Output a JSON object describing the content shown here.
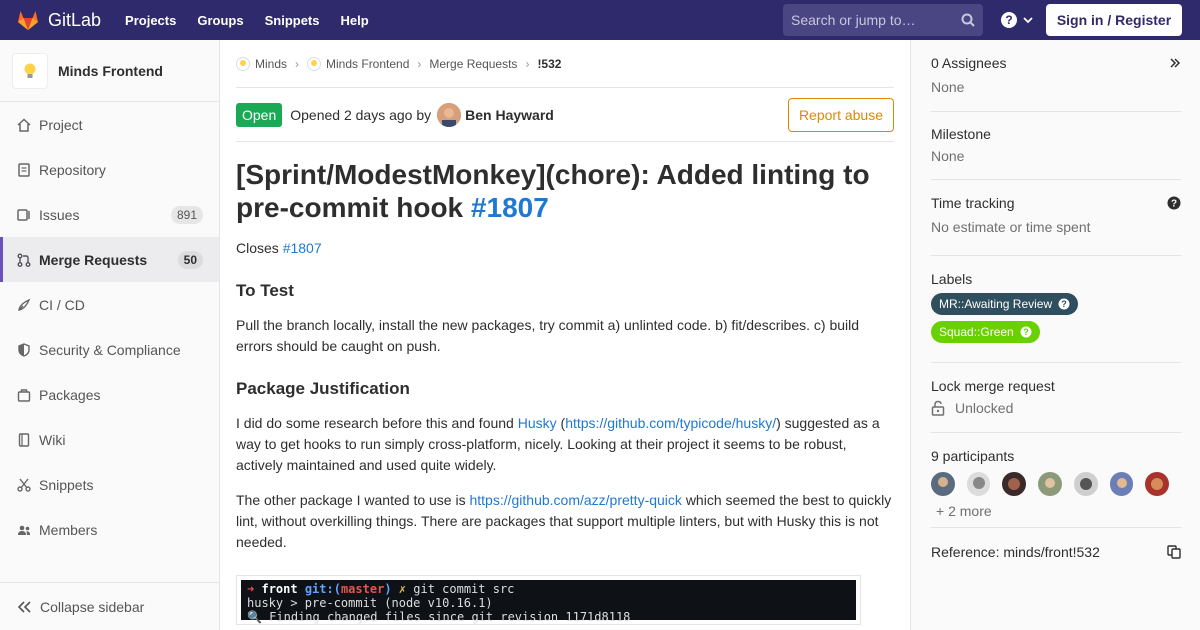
{
  "navbar": {
    "brand": "GitLab",
    "links": [
      "Projects",
      "Groups",
      "Snippets",
      "Help"
    ],
    "search_placeholder": "Search or jump to…",
    "signin": "Sign in / Register",
    "icons": [
      "gitlab-logo-icon",
      "search-icon",
      "help-icon",
      "chevron-down-icon"
    ]
  },
  "sidebar": {
    "project_name": "Minds Frontend",
    "items": [
      {
        "label": "Project",
        "icon": "home-icon"
      },
      {
        "label": "Repository",
        "icon": "doc-icon"
      },
      {
        "label": "Issues",
        "icon": "issues-icon",
        "badge": "891"
      },
      {
        "label": "Merge Requests",
        "icon": "merge-request-icon",
        "badge": "50",
        "active": true
      },
      {
        "label": "CI / CD",
        "icon": "rocket-icon"
      },
      {
        "label": "Security & Compliance",
        "icon": "shield-icon"
      },
      {
        "label": "Packages",
        "icon": "package-icon"
      },
      {
        "label": "Wiki",
        "icon": "book-icon"
      },
      {
        "label": "Snippets",
        "icon": "scissors-icon"
      },
      {
        "label": "Members",
        "icon": "users-icon"
      }
    ],
    "collapse": "Collapse sidebar"
  },
  "breadcrumb": {
    "items": [
      "Minds",
      "Minds Frontend",
      "Merge Requests"
    ],
    "current": "!532"
  },
  "mr": {
    "status": "Open",
    "opened_text": "Opened 2 days ago by",
    "author": "Ben Hayward",
    "report": "Report abuse",
    "title": "[Sprint/ModestMonkey](chore): Added linting to pre-commit hook",
    "title_ref": "#1807",
    "closes": "Closes",
    "closes_ref": "#1807",
    "h_test": "To Test",
    "p_test": "Pull the branch locally, install the new packages, try commit a) unlinted code. b) fit/describes. c) build errors should be caught on push.",
    "h_just": "Package Justification",
    "p_just_1": "I did do some research before this and found",
    "p_just_link1": "Husky",
    "p_just_paren_open": "(",
    "p_just_link2": "https://github.com/typicode/husky/",
    "p_just_2": ") suggested as a way to get hooks to run simply cross-platform, nicely. Looking at their project it seems to be robust, actively maintained and used quite widely.",
    "p_other_1": "The other package I wanted to use is",
    "p_other_link": "https://github.com/azz/pretty-quick",
    "p_other_2": "which seemed the best to quickly lint, without overkilling things. There are packages that support multiple linters, but with Husky this is not needed.",
    "terminal": {
      "line1_prompt": "➜",
      "line1_dir": "front",
      "line1_git": "git:(",
      "line1_branch": "master",
      "line1_close": ")",
      "line1_x": "✗",
      "line1_cmd": "git commit src",
      "line2": "husky > pre-commit (node v10.16.1)",
      "line3": "🔍 Finding changed files since git revision 1171d8118"
    }
  },
  "rside": {
    "assignees_title": "0 Assignees",
    "assignees_value": "None",
    "milestone_title": "Milestone",
    "milestone_value": "None",
    "time_title": "Time tracking",
    "time_value": "No estimate or time spent",
    "labels_title": "Labels",
    "labels": [
      {
        "name": "MR::Awaiting Review",
        "color": "#2f4f5e"
      },
      {
        "name": "Squad::Green",
        "color": "#69d100"
      }
    ],
    "lock_title": "Lock merge request",
    "lock_value": "Unlocked",
    "participants_title": "9 participants",
    "participants_more": "+ 2 more",
    "reference": "Reference: minds/front!532"
  }
}
